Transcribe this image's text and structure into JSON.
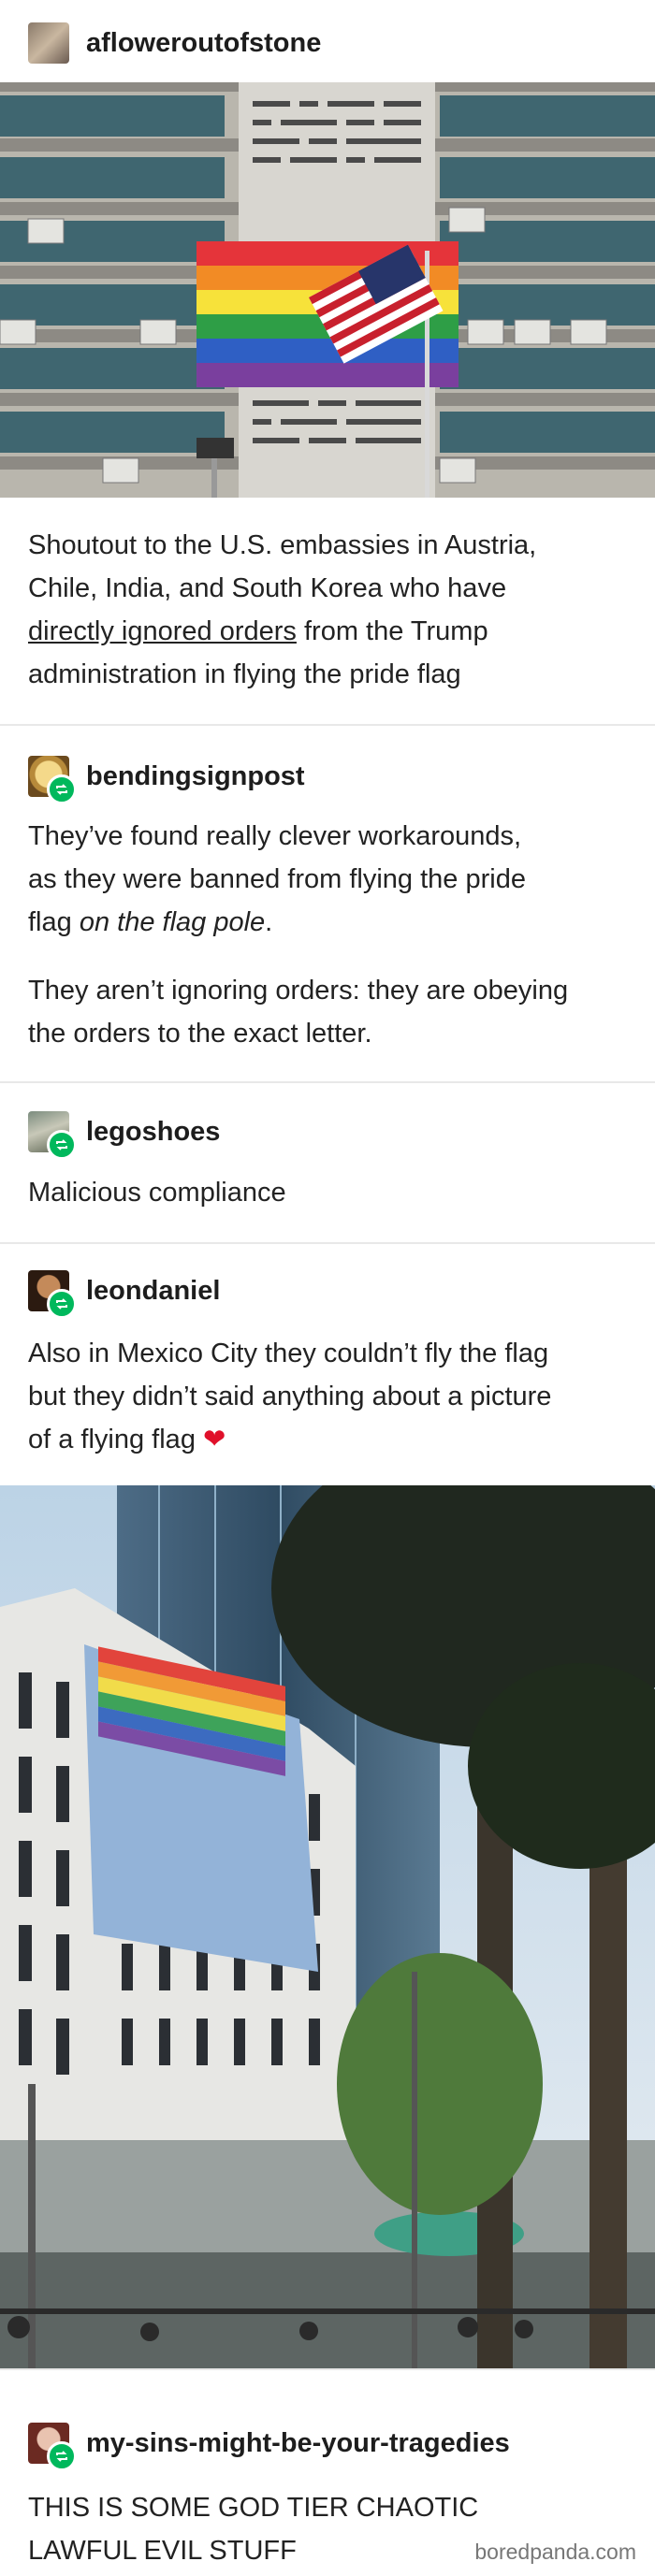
{
  "posts": [
    {
      "username": "aflowerout​ofstone"
    },
    {
      "username": "bendingsignpost"
    },
    {
      "username": "legoshoes"
    },
    {
      "username": "leondaniel"
    },
    {
      "username": "my-sins-might-be-your-tragedies"
    }
  ],
  "post1": {
    "line1": "Shoutout to the U.S. embassies in Austria,",
    "line2": "Chile, India, and South Korea who have",
    "link": "directly ignored orders",
    "line3_rest": " from the Trump",
    "line4": "administration in flying the pride flag"
  },
  "post2": {
    "p1_line1": "They’ve found really clever workarounds,",
    "p1_line2": "as they were banned from flying the pride",
    "p1_line3_a": "flag ",
    "p1_line3_em": "on the flag pole",
    "p1_line3_b": ".",
    "p2_line1": "They aren’t ignoring orders: they are obeying",
    "p2_line2": "the orders to the exact letter."
  },
  "post3": {
    "text": "Malicious compliance"
  },
  "post4": {
    "line1": "Also in Mexico City they couldn’t fly the flag",
    "line2": "but they didn’t said anything about a picture",
    "line3": "of a flying flag",
    "emoji": "❤"
  },
  "post5": {
    "line1": "THIS IS SOME GOD TIER CHAOTIC",
    "line2": "LAWFUL EVIL STUFF"
  },
  "watermark": "boredpanda.com",
  "colors": {
    "reblog": "#00b85c",
    "heart": "#e0102a"
  }
}
